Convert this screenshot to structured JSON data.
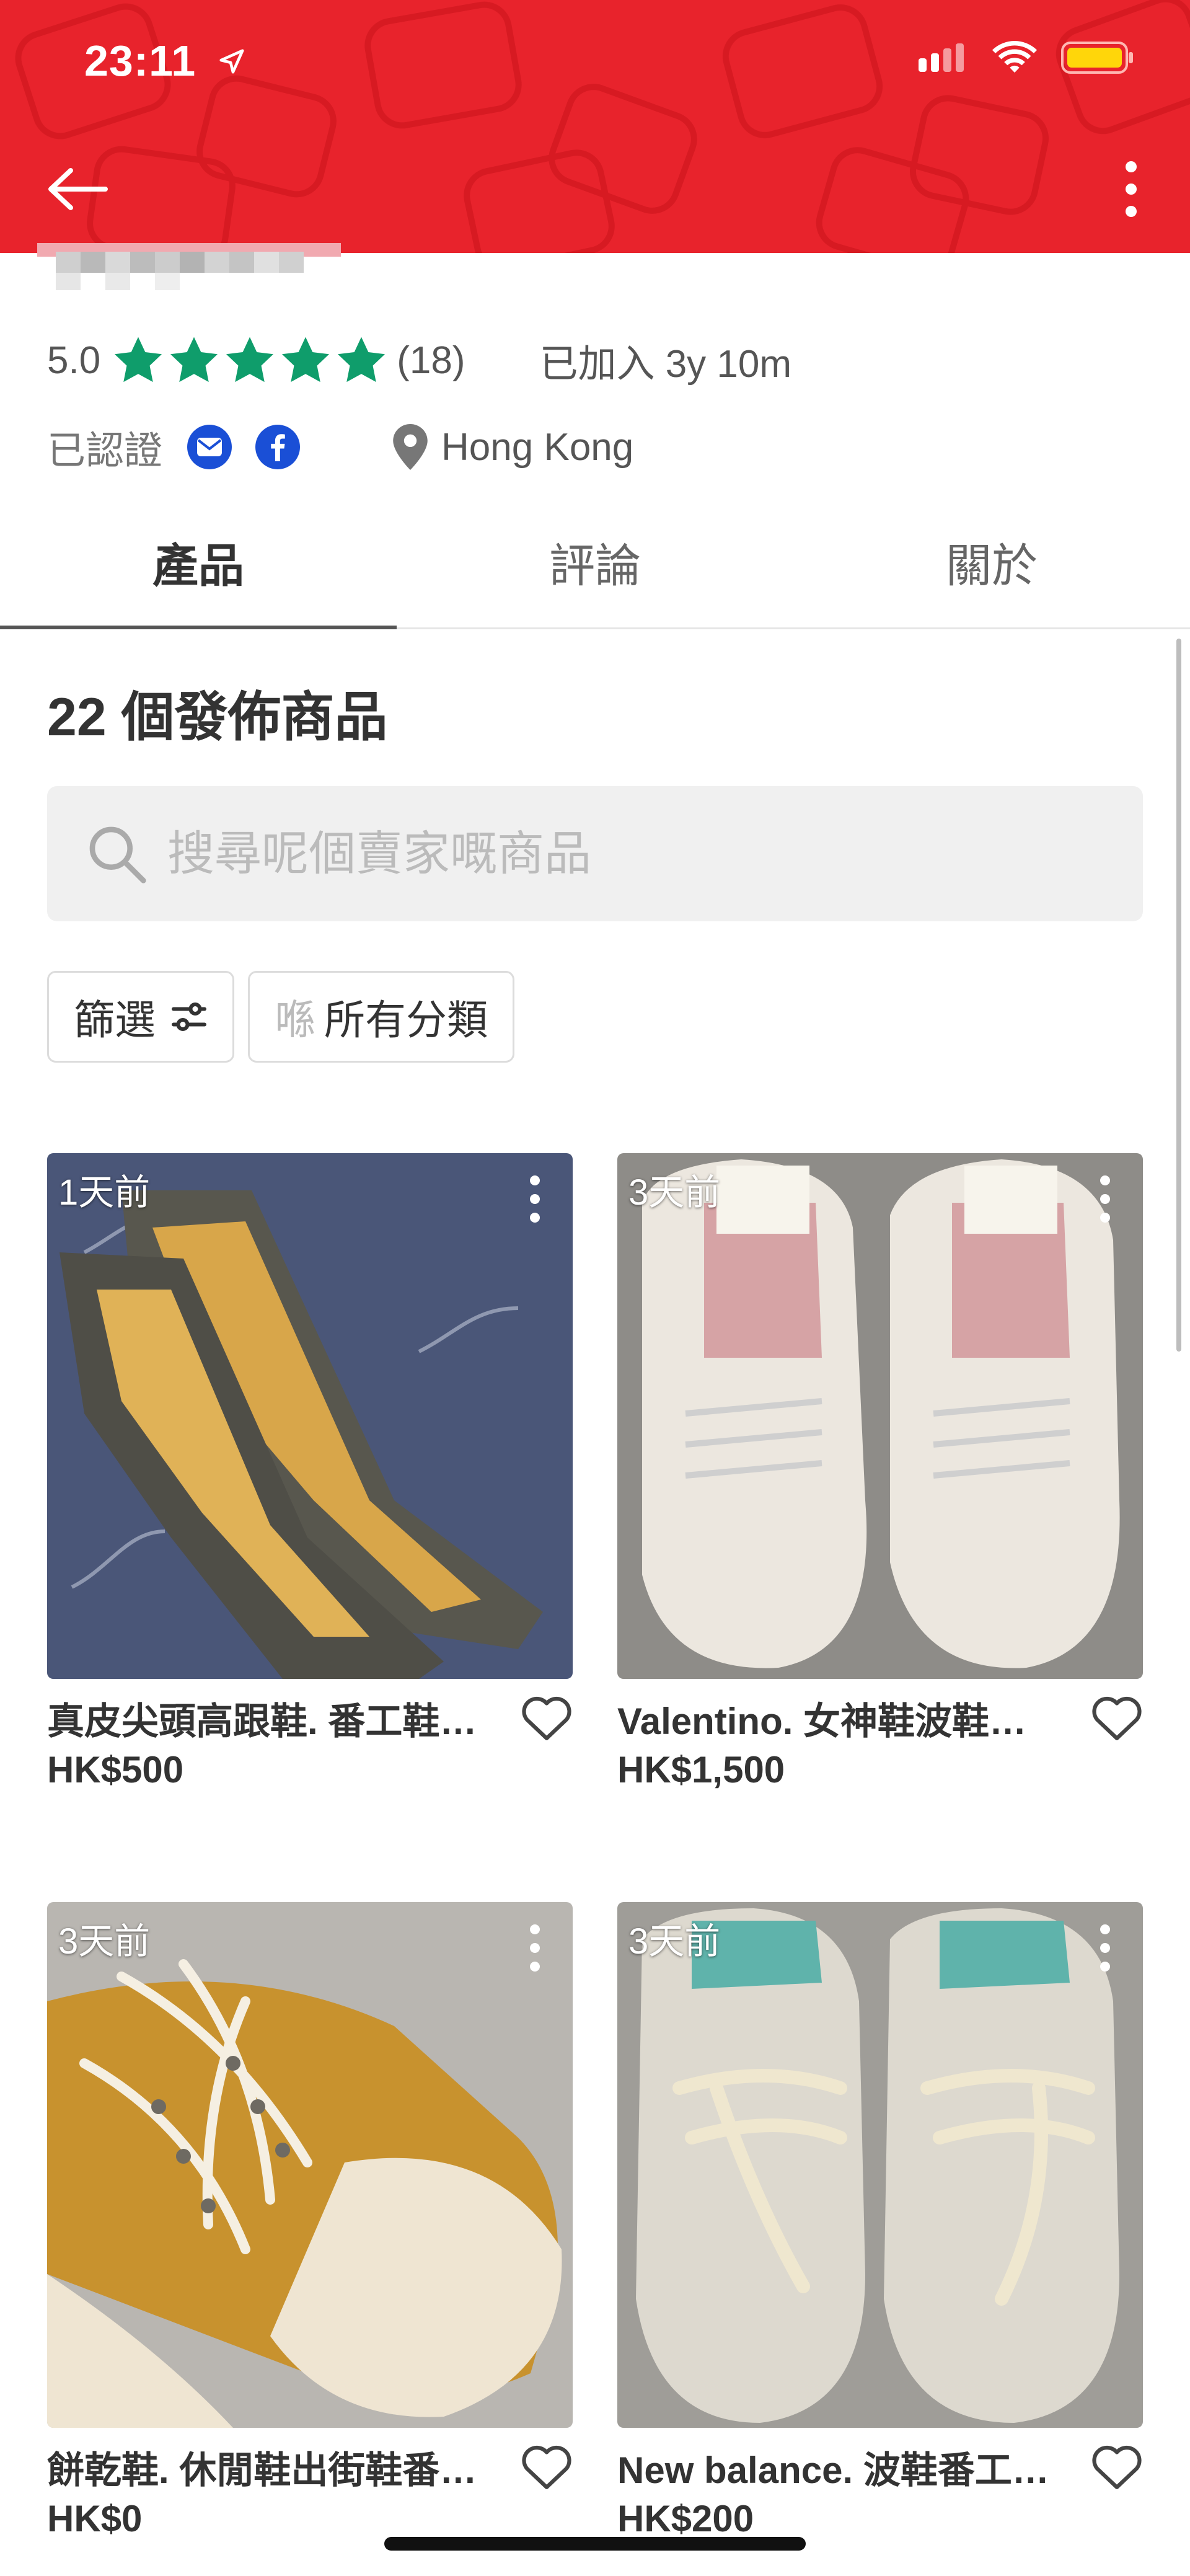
{
  "status_bar": {
    "time": "23:11"
  },
  "profile": {
    "score": "5.0",
    "stars": 5,
    "review_count": "(18)",
    "joined": "已加入 3y 10m",
    "verified_label": "已認證",
    "location": "Hong Kong"
  },
  "tabs": [
    {
      "label": "產品",
      "active": true
    },
    {
      "label": "評論",
      "active": false
    },
    {
      "label": "關於",
      "active": false
    }
  ],
  "listing_count": "22 個發佈商品",
  "search": {
    "placeholder": "搜尋呢個賣家嘅商品",
    "value": ""
  },
  "filters": {
    "filter_label": "篩選",
    "category_prefix": "喺",
    "category_label": "所有分類"
  },
  "products": [
    {
      "age": "1天前",
      "title": "真皮尖頭高跟鞋. 番工鞋…",
      "price": "HK$500"
    },
    {
      "age": "3天前",
      "title": "Valentino. 女神鞋波鞋番…",
      "price": "HK$1,500"
    },
    {
      "age": "3天前",
      "title": "餅乾鞋. 休閒鞋出街鞋番…",
      "price": "HK$0"
    },
    {
      "age": "3天前",
      "title": "New balance. 波鞋番工…",
      "price": "HK$200"
    }
  ],
  "colors": {
    "brand_red": "#e8232c",
    "verify_blue": "#1a4fd6",
    "star_green": "#0f9d6b"
  },
  "icons": [
    "back-arrow-icon",
    "more-vertical-icon",
    "star-icon",
    "mail-icon",
    "facebook-icon",
    "location-pin-icon",
    "search-icon",
    "filter-sliders-icon",
    "heart-icon",
    "kebab-icon"
  ]
}
